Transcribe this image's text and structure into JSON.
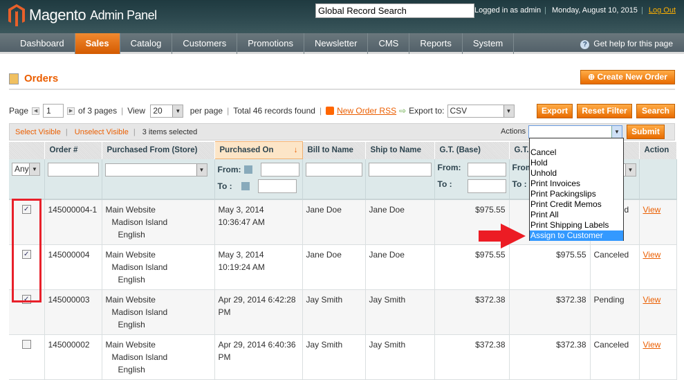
{
  "header": {
    "logo_text": "Magento",
    "logo_sub": "Admin Panel",
    "search_value": "Global Record Search",
    "logged_in": "Logged in as admin",
    "date": "Monday, August 10, 2015",
    "logout": "Log Out"
  },
  "nav": {
    "items": [
      "Dashboard",
      "Sales",
      "Catalog",
      "Customers",
      "Promotions",
      "Newsletter",
      "CMS",
      "Reports",
      "System"
    ],
    "active": "Sales",
    "help": "Get help for this page"
  },
  "page": {
    "title": "Orders",
    "create_button": "Create New Order"
  },
  "pager": {
    "page_label": "Page",
    "page": "1",
    "of_pages": "of 3 pages",
    "view_label": "View",
    "per_page": "20",
    "per_page_label": "per page",
    "total": "Total 46 records found",
    "rss": "New Order RSS",
    "export_label": "Export to:",
    "export_format": "CSV",
    "export_button": "Export",
    "reset_button": "Reset Filter",
    "search_button": "Search"
  },
  "massaction": {
    "select_visible": "Select Visible",
    "unselect_visible": "Unselect Visible",
    "selected": "3 items selected",
    "actions_label": "Actions",
    "submit": "Submit",
    "options": [
      "Cancel",
      "Hold",
      "Unhold",
      "Print Invoices",
      "Print Packingslips",
      "Print Credit Memos",
      "Print All",
      "Print Shipping Labels",
      "Assign to Customer"
    ],
    "highlighted": "Assign to Customer"
  },
  "columns": [
    "",
    "Order #",
    "Purchased From (Store)",
    "Purchased On",
    "Bill to Name",
    "Ship to Name",
    "G.T. (Base)",
    "G.T. (Purchased)",
    "Status",
    "Action"
  ],
  "filter": {
    "any": "Any",
    "from": "From:",
    "to": "To :"
  },
  "rows": [
    {
      "checked": true,
      "order": "145000004-1",
      "store": [
        "Main Website",
        "Madison Island",
        "English"
      ],
      "date": "May 3, 2014 10:36:47 AM",
      "bill": "Jane Doe",
      "ship": "Jane Doe",
      "gt_base": "$975.55",
      "gt_purchased": "$975.55",
      "status": "Canceled",
      "action": "View"
    },
    {
      "checked": true,
      "order": "145000004",
      "store": [
        "Main Website",
        "Madison Island",
        "English"
      ],
      "date": "May 3, 2014 10:19:24 AM",
      "bill": "Jane Doe",
      "ship": "Jane Doe",
      "gt_base": "$975.55",
      "gt_purchased": "$975.55",
      "status": "Canceled",
      "action": "View"
    },
    {
      "checked": true,
      "order": "145000003",
      "store": [
        "Main Website",
        "Madison Island",
        "English"
      ],
      "date": "Apr 29, 2014 6:42:28 PM",
      "bill": "Jay Smith",
      "ship": "Jay Smith",
      "gt_base": "$372.38",
      "gt_purchased": "$372.38",
      "status": "Pending",
      "action": "View"
    },
    {
      "checked": false,
      "order": "145000002",
      "store": [
        "Main Website",
        "Madison Island",
        "English"
      ],
      "date": "Apr 29, 2014 6:40:36 PM",
      "bill": "Jay Smith",
      "ship": "Jay Smith",
      "gt_base": "$372.38",
      "gt_purchased": "$372.38",
      "status": "Canceled",
      "action": "View"
    }
  ],
  "colors": {
    "accent": "#eb5e00",
    "highlight_box": "#e8202a",
    "selected_option": "#3399ff"
  }
}
